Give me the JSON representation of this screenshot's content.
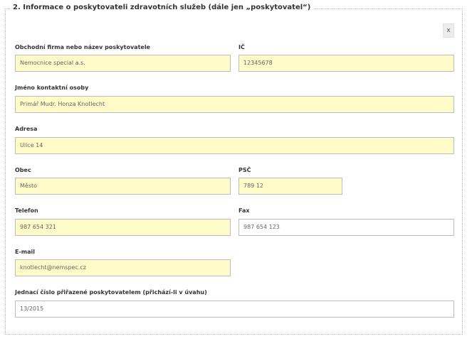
{
  "section": {
    "title": "2. Informace o poskytovateli zdravotních služeb (dále jen „poskytovatel“)",
    "close_label": "x"
  },
  "fields": {
    "company": {
      "label": "Obchodní firma nebo název poskytovatele",
      "value": "Nemocnice special a.s."
    },
    "ic": {
      "label": "IČ",
      "value": "12345678"
    },
    "contact": {
      "label": "Jméno kontaktní osoby",
      "value": "Primář Mudr. Honza Knotlecht"
    },
    "address": {
      "label": "Adresa",
      "value": "Ulice 14"
    },
    "city": {
      "label": "Obec",
      "value": "Město"
    },
    "psc": {
      "label": "PSČ",
      "value": "789 12"
    },
    "phone": {
      "label": "Telefon",
      "value": "987 654 321"
    },
    "fax": {
      "label": "Fax",
      "value": "987 654 123"
    },
    "email": {
      "label": "E-mail",
      "value": "knotlecht@nemspec.cz"
    },
    "ref_number": {
      "label": "Jednací číslo přiřazené poskytovatelem (přichází-li v úvahu)",
      "value": "13/2015"
    }
  }
}
